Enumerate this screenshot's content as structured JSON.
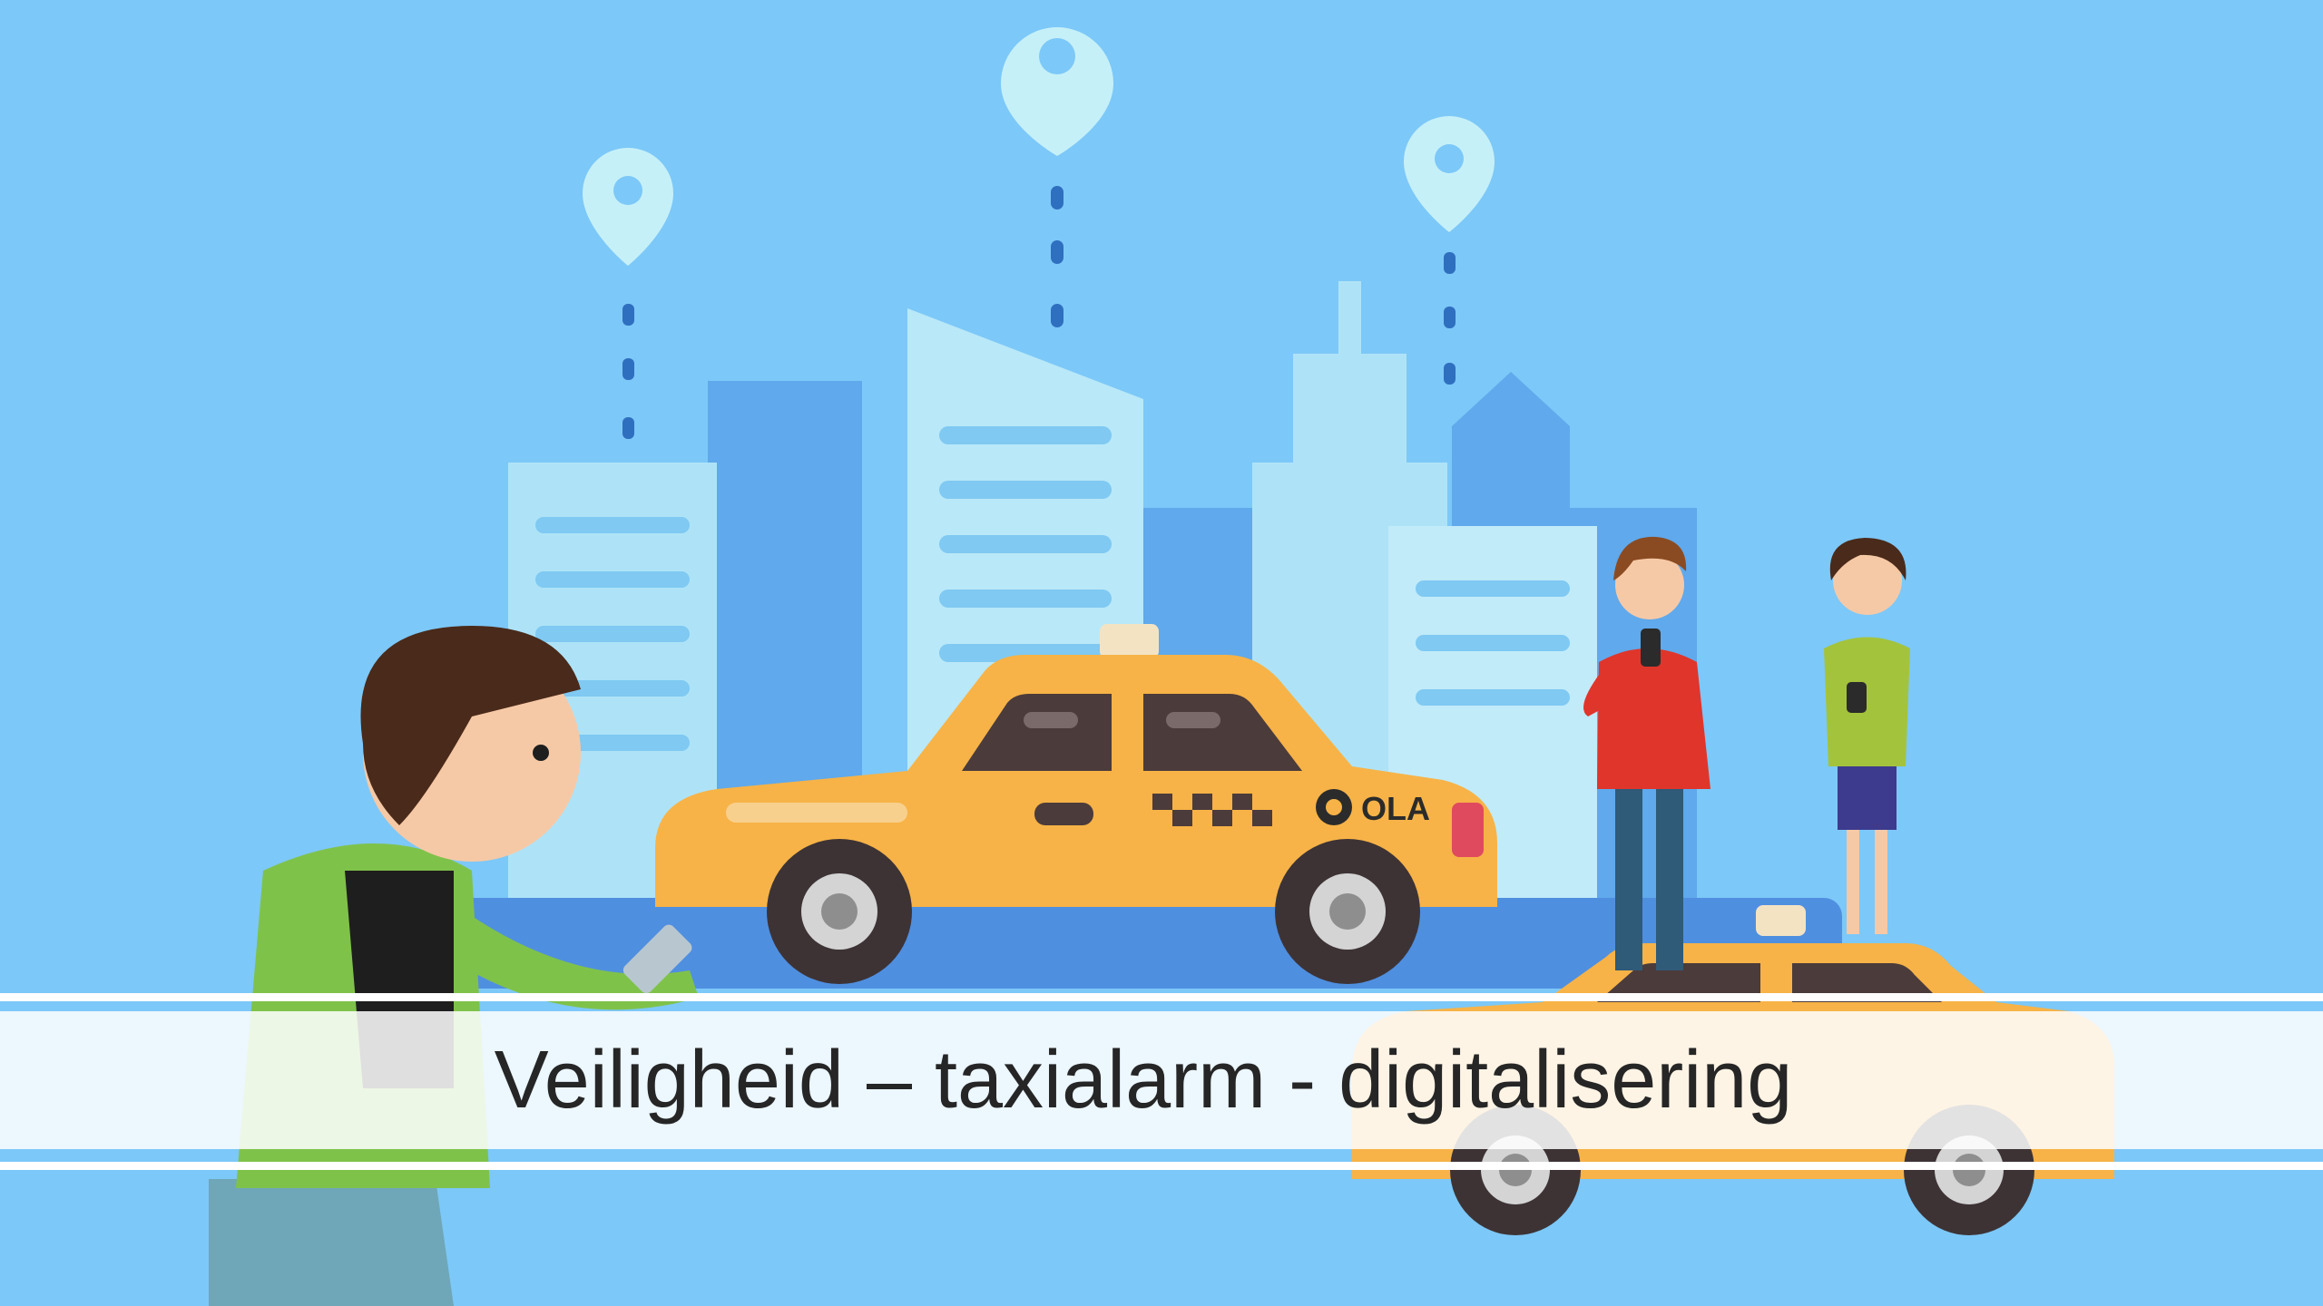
{
  "slide": {
    "title": "Veiligheid – taxialarm - digitalisering",
    "illustration": {
      "taxi_sign_brand": "OLA",
      "icons": [
        "location-pin-icon",
        "location-pin-icon",
        "location-pin-icon",
        "taxi-icon",
        "smartphone-icon"
      ]
    }
  },
  "colors": {
    "sky": "#7cc8f8",
    "building_light": "#aee3f7",
    "building_dark": "#5aa7ec",
    "taxi_yellow": "#f7b347",
    "title_text": "#262626",
    "band": "#ffffff"
  }
}
